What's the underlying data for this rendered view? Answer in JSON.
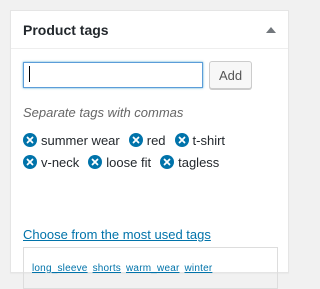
{
  "panel": {
    "title": "Product tags",
    "toggle_icon": "triangle-up-icon"
  },
  "tag_input": {
    "value": "",
    "placeholder": ""
  },
  "add_button": {
    "label": "Add"
  },
  "howto": "Separate tags with commas",
  "tags": [
    {
      "label": "summer wear"
    },
    {
      "label": "red"
    },
    {
      "label": "t-shirt"
    },
    {
      "label": "v-neck"
    },
    {
      "label": "loose fit"
    },
    {
      "label": "tagless"
    }
  ],
  "remove_icon": "remove-circle-icon",
  "most_used_link": "Choose from the most used tags",
  "tag_cloud": [
    {
      "label": "long_sleeve"
    },
    {
      "label": "shorts"
    },
    {
      "label": "warm_wear"
    },
    {
      "label": "winter"
    }
  ],
  "colors": {
    "accent": "#0073aa",
    "text": "#23282d",
    "muted": "#666666",
    "focus_border": "#5b9dd9"
  }
}
